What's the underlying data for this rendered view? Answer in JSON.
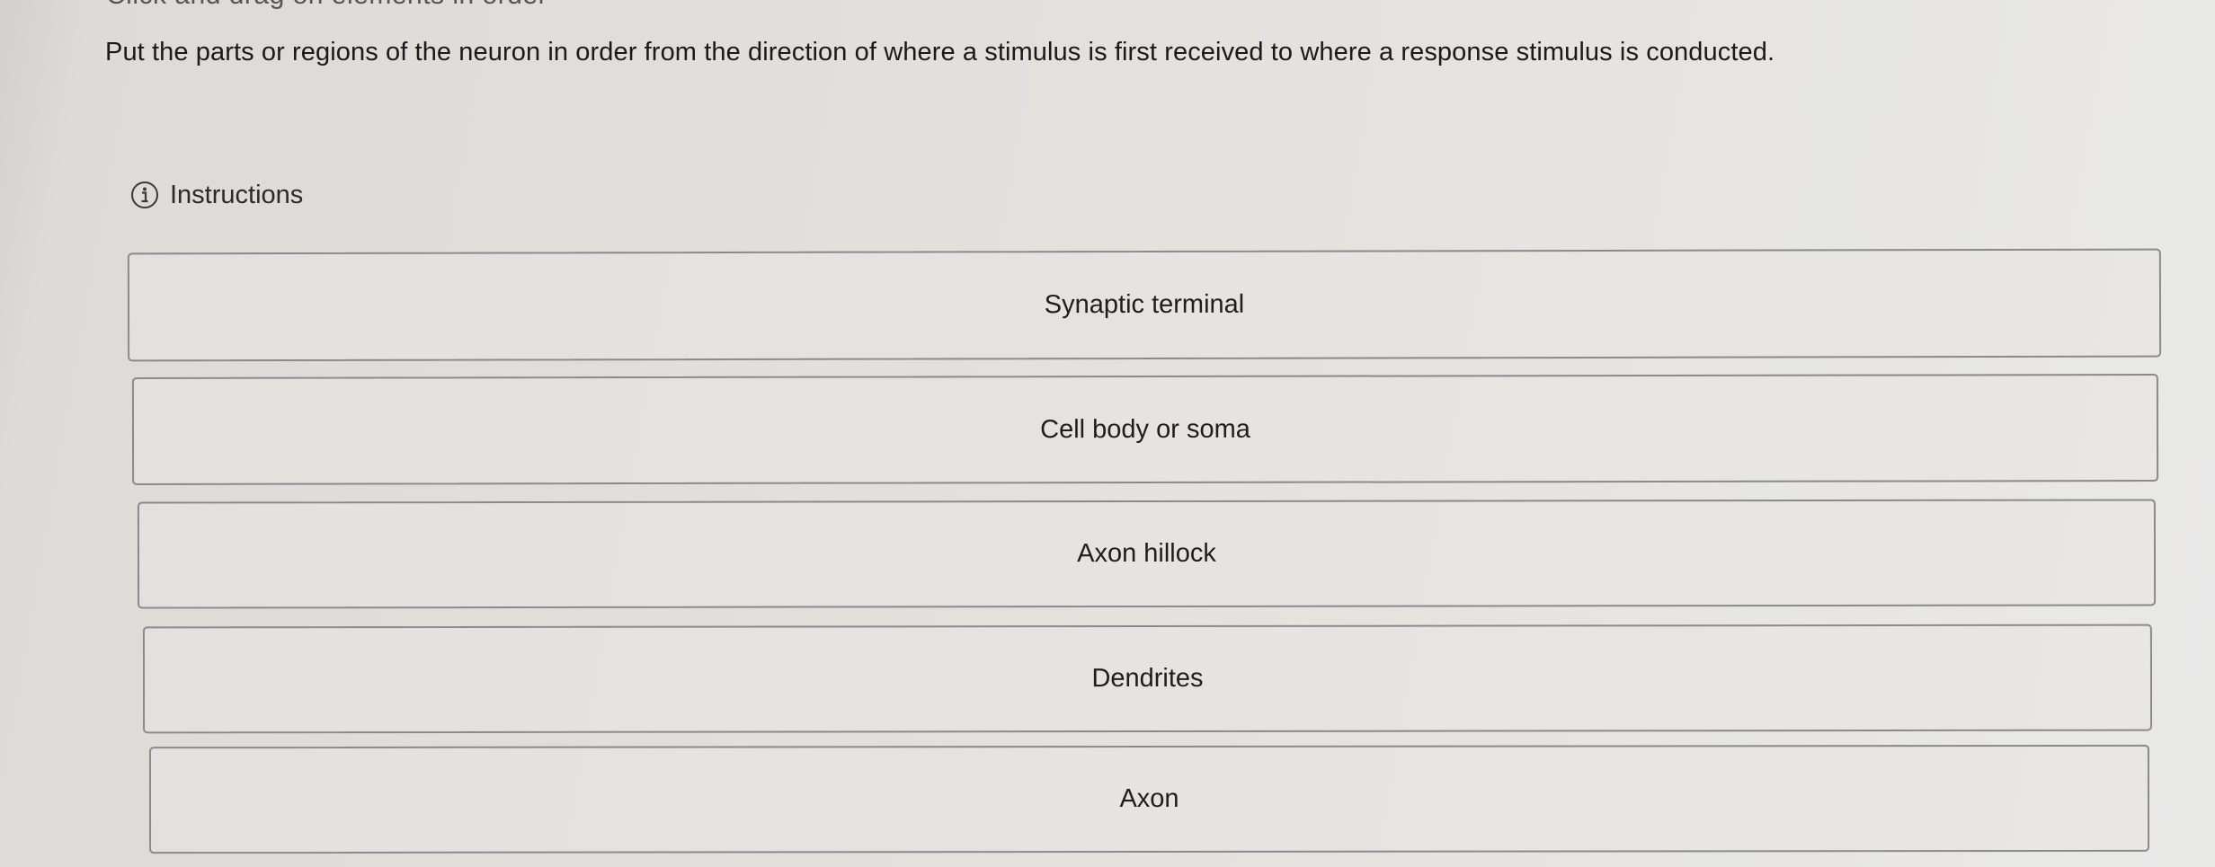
{
  "header": {
    "cut_text": "Click and drag on elements in order"
  },
  "question": {
    "text": "Put the parts or regions of the neuron in order from the direction of where a stimulus is first received to where a response stimulus is conducted."
  },
  "instructions": {
    "label": "Instructions",
    "icon": "info-circle-icon"
  },
  "items": [
    {
      "label": "Synaptic terminal"
    },
    {
      "label": "Cell body or soma"
    },
    {
      "label": "Axon hillock"
    },
    {
      "label": "Dendrites"
    },
    {
      "label": "Axon"
    }
  ]
}
